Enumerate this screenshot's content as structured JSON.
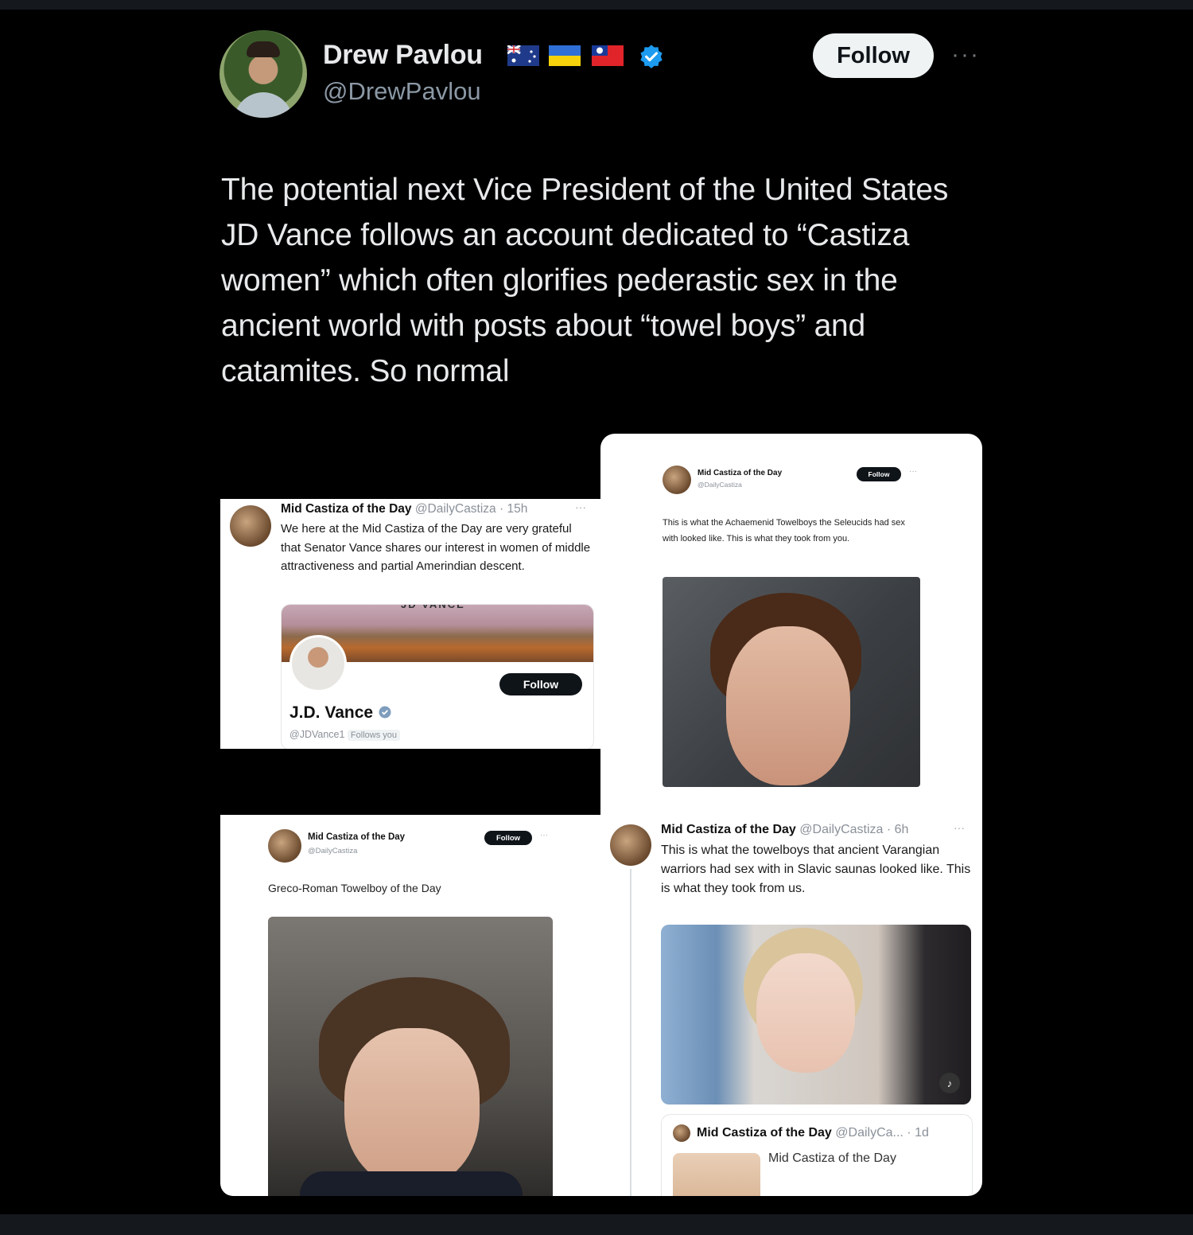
{
  "author": {
    "name": "Drew Pavlou",
    "handle": "@DrewPavlou",
    "follow_label": "Follow",
    "more_label": "···",
    "flags": [
      "australia-flag-icon",
      "ukraine-flag-icon",
      "taiwan-flag-icon"
    ],
    "verified_color": "#1d9bf0"
  },
  "tweet": {
    "text": "The potential next Vice President of the United States JD Vance follows an account dedicated to “Castiza women” which often glorifies pederastic sex in the ancient world with posts about “towel boys” and catamites. So normal"
  },
  "screenshots": {
    "a": {
      "name": "Mid Castiza of the Day",
      "meta": "@DailyCastiza · 15h",
      "more": "···",
      "text": "We here at the Mid Castiza of the Day are very grateful that Senator Vance shares our interest in women of middle attractiveness and partial Amerindian descent.",
      "card_banner_text": "JD VANCE",
      "card_follow": "Follow",
      "card_name": "J.D. Vance",
      "card_handle": "@JDVance1",
      "card_follows_you": "Follows you"
    },
    "b": {
      "name": "Mid Castiza of the Day",
      "handle": "@DailyCastiza",
      "follow": "Follow",
      "more": "···",
      "text": "This is what the Achaemenid Towelboys the Seleucids had sex with looked like. This is what they took from you."
    },
    "c": {
      "name": "Mid Castiza of the Day",
      "handle": "@DailyCastiza",
      "follow": "Follow",
      "more": "···",
      "text": "Greco-Roman Towelboy of the Day"
    },
    "d": {
      "name": "Mid Castiza of the Day",
      "meta": "@DailyCastiza · 6h",
      "more": "···",
      "text": "This is what the towelboys that ancient Varangian warriors had sex with in Slavic saunas looked like. This is what they took from us.",
      "quote_name": "Mid Castiza of the Day",
      "quote_meta": "@DailyCa... · 1d",
      "quote_text": "Mid Castiza of the Day"
    }
  }
}
